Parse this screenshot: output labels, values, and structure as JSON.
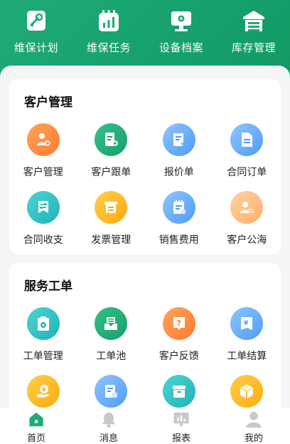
{
  "top_nav": [
    {
      "label": "维保计划",
      "icon": "wrench-doc-icon"
    },
    {
      "label": "维保任务",
      "icon": "calendar-chart-icon"
    },
    {
      "label": "设备档案",
      "icon": "monitor-gear-icon"
    },
    {
      "label": "库存管理",
      "icon": "warehouse-icon"
    }
  ],
  "sections": [
    {
      "title": "客户管理",
      "items": [
        {
          "label": "客户管理",
          "icon": "user-gear-icon",
          "color": "#ff8a3d"
        },
        {
          "label": "客户跟单",
          "icon": "doc-gear-icon",
          "color": "#1faa76"
        },
        {
          "label": "报价单",
          "icon": "quote-doc-icon",
          "color": "#5ea6f7"
        },
        {
          "label": "合同订单",
          "icon": "doc-icon",
          "color": "#5ea6f7"
        },
        {
          "label": "合同收支",
          "icon": "exchange-icon",
          "color": "#23b9b9"
        },
        {
          "label": "发票管理",
          "icon": "invoice-icon",
          "color": "#ffb21e"
        },
        {
          "label": "销售费用",
          "icon": "notepad-icon",
          "color": "#5ea6f7"
        },
        {
          "label": "客户公海",
          "icon": "user-card-icon",
          "color": "#ffb878"
        }
      ]
    },
    {
      "title": "服务工单",
      "items": [
        {
          "label": "工单管理",
          "icon": "clipboard-gear-icon",
          "color": "#23b9b9"
        },
        {
          "label": "工单池",
          "icon": "inbox-icon",
          "color": "#1faa76"
        },
        {
          "label": "客户反馈",
          "icon": "question-icon",
          "color": "#ff8a3d"
        },
        {
          "label": "工单结算",
          "icon": "yen-doc-icon",
          "color": "#5ea6f7"
        },
        {
          "label": "",
          "icon": "yen-hand-icon",
          "color": "#ffb21e"
        },
        {
          "label": "",
          "icon": "doc-table-icon",
          "color": "#5ea6f7"
        },
        {
          "label": "",
          "icon": "archive-icon",
          "color": "#23b9b9"
        },
        {
          "label": "",
          "icon": "box-icon",
          "color": "#ffb21e"
        }
      ]
    }
  ],
  "tabbar": [
    {
      "label": "首页",
      "icon": "home-icon",
      "active": true
    },
    {
      "label": "消息",
      "icon": "bell-icon",
      "active": false
    },
    {
      "label": "报表",
      "icon": "report-icon",
      "active": false
    },
    {
      "label": "我的",
      "icon": "user-icon",
      "active": false
    }
  ],
  "colors": {
    "brand": "#1faa76",
    "inactive_tab": "#c8c8c8"
  }
}
